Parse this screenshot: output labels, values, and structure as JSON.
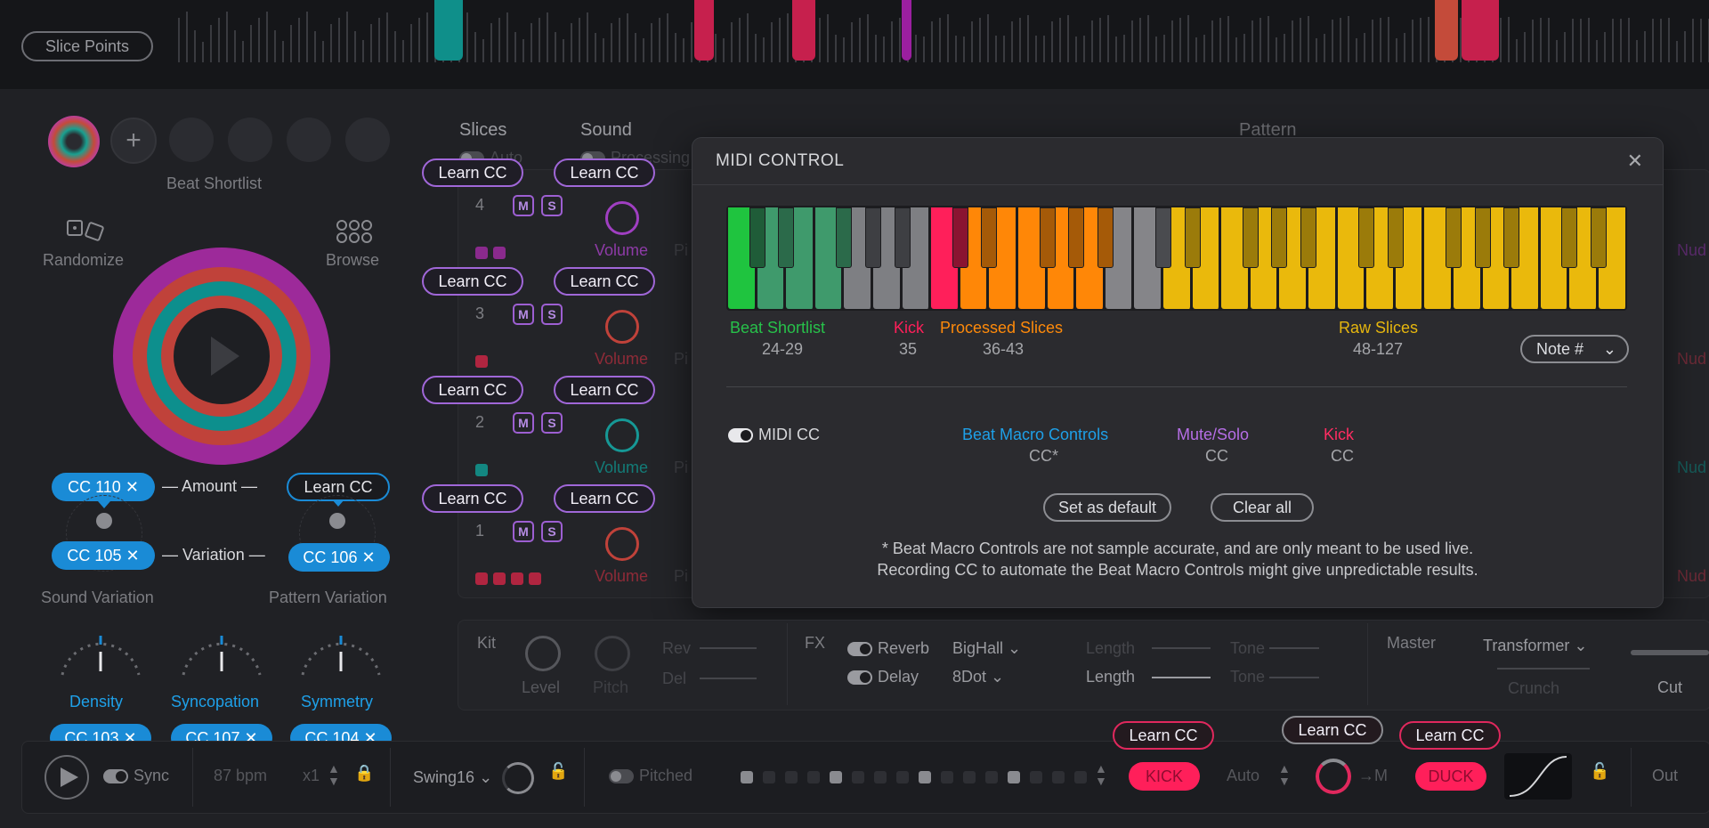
{
  "top": {
    "slice_points_label": "Slice Points"
  },
  "beat_shortlist": {
    "label": "Beat Shortlist",
    "add_symbol": "+"
  },
  "randomize": {
    "label": "Randomize"
  },
  "browse": {
    "label": "Browse"
  },
  "macros": {
    "amount_label": "— Amount —",
    "variation_label": "— Variation —",
    "amount_left_cc": "CC 110",
    "amount_right_cc": "Learn CC",
    "variation_left_cc": "CC 105",
    "variation_right_cc": "CC 106",
    "sound_variation_label": "Sound Variation",
    "pattern_variation_label": "Pattern Variation",
    "density_label": "Density",
    "syncopation_label": "Syncopation",
    "symmetry_label": "Symmetry",
    "density_cc": "CC 103",
    "syncopation_cc": "CC 107",
    "symmetry_cc": "CC 104"
  },
  "columns": {
    "slices": "Slices",
    "sound": "Sound",
    "pattern": "Pattern",
    "auto": "Auto",
    "processing": "Processing"
  },
  "tracks": [
    {
      "number": "4",
      "learn_left": "Learn CC",
      "learn_right": "Learn CC",
      "mute": "M",
      "solo": "S",
      "volume": "Volume",
      "pitch": "Pi",
      "nudge": "Nud"
    },
    {
      "number": "3",
      "learn_left": "Learn CC",
      "learn_right": "Learn CC",
      "mute": "M",
      "solo": "S",
      "volume": "Volume",
      "pitch": "Pi",
      "nudge": "Nud"
    },
    {
      "number": "2",
      "learn_left": "Learn CC",
      "learn_right": "Learn CC",
      "mute": "M",
      "solo": "S",
      "volume": "Volume",
      "pitch": "Pi",
      "nudge": "Nud"
    },
    {
      "number": "1",
      "learn_left": "Learn CC",
      "learn_right": "Learn CC",
      "mute": "M",
      "solo": "S",
      "volume": "Volume",
      "pitch": "Pi",
      "nudge": "Nud"
    }
  ],
  "modal": {
    "title": "MIDI CONTROL",
    "close_symbol": "✕",
    "zones": [
      {
        "name": "Beat Shortlist",
        "range": "24-29",
        "color": "#27c14a"
      },
      {
        "name": "Kick",
        "range": "35",
        "color": "#ff1f5a"
      },
      {
        "name": "Processed Slices",
        "range": "36-43",
        "color": "#ff8a0a"
      },
      {
        "name": "Raw Slices",
        "range": "48-127",
        "color": "#e6b60e"
      }
    ],
    "note_dropdown": "Note #",
    "midi_cc_label": "MIDI CC",
    "cc_groups": [
      {
        "name": "Beat Macro Controls",
        "value": "CC*",
        "color": "#1ea0e8"
      },
      {
        "name": "Mute/Solo",
        "value": "CC",
        "color": "#b66ee6"
      },
      {
        "name": "Kick",
        "value": "CC",
        "color": "#ff2d62"
      }
    ],
    "set_default_label": "Set as default",
    "clear_all_label": "Clear all",
    "footnote_line1": "* Beat Macro Controls are not sample accurate, and are only meant to be used live.",
    "footnote_line2": "Recording CC to automate the Beat Macro Controls might give unpredictable results."
  },
  "kit": {
    "label": "Kit",
    "level": "Level",
    "pitch": "Pitch",
    "rev": "Rev",
    "del": "Del"
  },
  "fx": {
    "label": "FX",
    "reverb": "Reverb",
    "delay": "Delay",
    "reverb_type": "BigHall",
    "delay_type": "8Dot",
    "length": "Length",
    "tone": "Tone"
  },
  "master": {
    "label": "Master",
    "effect": "Transformer",
    "crunch": "Crunch",
    "cut": "Cut"
  },
  "transport": {
    "sync": "Sync",
    "bpm": "87 bpm",
    "mult": "x1",
    "swing": "Swing16",
    "pitched": "Pitched",
    "kick": "KICK",
    "kick_learn": "Learn CC",
    "auto": "Auto",
    "knob_learn": "Learn CC",
    "to_m": "→M",
    "duck": "DUCK",
    "duck_learn": "Learn CC",
    "out": "Out"
  },
  "colors": {
    "accent_blue": "#1a8bd6",
    "accent_purple": "#a067d8",
    "accent_red": "#e0285d"
  }
}
